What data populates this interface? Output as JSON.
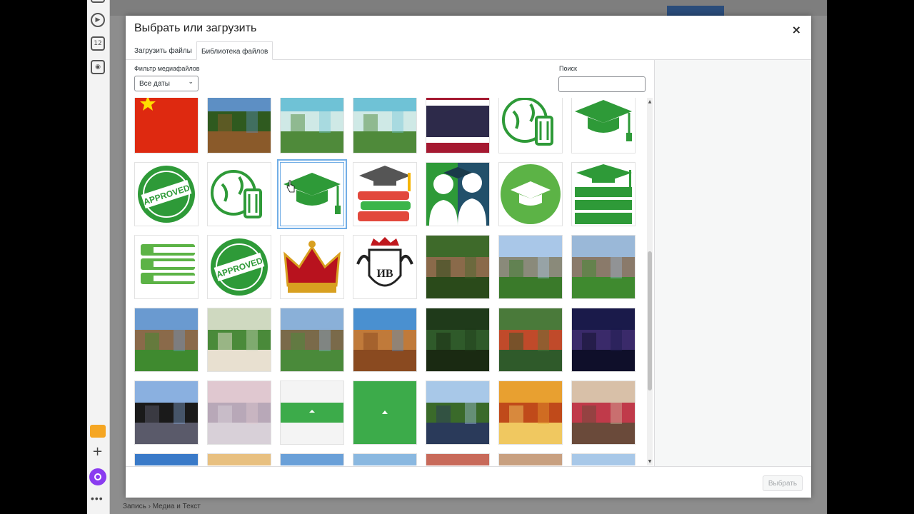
{
  "modal": {
    "title": "Выбрать или загрузить",
    "close_label": "×",
    "tabs": [
      {
        "label": "Загрузить файлы",
        "active": false
      },
      {
        "label": "Библиотека файлов",
        "active": true
      }
    ],
    "filter": {
      "label": "Фильтр медиафайлов",
      "selected": "Все даты"
    },
    "search": {
      "label": "Поиск",
      "placeholder": ""
    },
    "select_button": "Выбрать"
  },
  "browser": {
    "badge_count": "12"
  },
  "status_bar": {
    "breadcrumb": "Запись  ›  Медиа и Текст"
  },
  "media": [
    {
      "name": "china-flag",
      "kind": "flag-china"
    },
    {
      "name": "pagoda-lake",
      "kind": "photo",
      "colors": [
        "#5d8fc4",
        "#2f5a1f",
        "#8a5a2a"
      ]
    },
    {
      "name": "beach-boats",
      "kind": "photo",
      "colors": [
        "#6fc2d6",
        "#cfe9e6",
        "#4f8a3a"
      ]
    },
    {
      "name": "beach-boats-2",
      "kind": "photo",
      "colors": [
        "#6fc2d6",
        "#cfe9e6",
        "#4f8a3a"
      ]
    },
    {
      "name": "thai-flag",
      "kind": "flag-thai"
    },
    {
      "name": "globe-luggage-icon",
      "kind": "icon-globe"
    },
    {
      "name": "graduation-cap-icon",
      "kind": "icon-cap"
    },
    {
      "name": "approved-stamp",
      "kind": "icon-approved"
    },
    {
      "name": "globe-luggage-icon-2",
      "kind": "icon-globe"
    },
    {
      "name": "graduation-cap-icon-selected",
      "kind": "icon-cap",
      "selected": true
    },
    {
      "name": "books-cap-icon",
      "kind": "icon-books-color"
    },
    {
      "name": "students-icon",
      "kind": "icon-students"
    },
    {
      "name": "cap-circle-icon",
      "kind": "icon-cap-circle"
    },
    {
      "name": "books-cap-green-icon",
      "kind": "icon-books-green"
    },
    {
      "name": "books-green-icon",
      "kind": "icon-books-outline"
    },
    {
      "name": "approved-stamp-2",
      "kind": "icon-approved"
    },
    {
      "name": "crown-icon",
      "kind": "icon-crown"
    },
    {
      "name": "crest-icon",
      "kind": "icon-crest"
    },
    {
      "name": "castle-forest",
      "kind": "photo",
      "colors": [
        "#3e6a2a",
        "#8a6a4a",
        "#2a4a1a"
      ]
    },
    {
      "name": "palace-garden",
      "kind": "photo",
      "colors": [
        "#a9c7e8",
        "#8a8a7a",
        "#3a7a2a"
      ]
    },
    {
      "name": "college-lawn",
      "kind": "photo",
      "colors": [
        "#9ab8d8",
        "#8a7a6a",
        "#3f8a2f"
      ]
    },
    {
      "name": "students-lawn",
      "kind": "photo",
      "colors": [
        "#6a9ad0",
        "#8a6a4a",
        "#3f8a2f"
      ]
    },
    {
      "name": "students-sitting",
      "kind": "photo",
      "colors": [
        "#cfd9c0",
        "#4a8a3a",
        "#e8e0d0"
      ]
    },
    {
      "name": "mosque",
      "kind": "photo",
      "colors": [
        "#8ab0d8",
        "#7a6a4a",
        "#4a8a3a"
      ]
    },
    {
      "name": "desert-town",
      "kind": "photo",
      "colors": [
        "#4a90d0",
        "#c07a3a",
        "#8a4a20"
      ]
    },
    {
      "name": "jungle",
      "kind": "photo",
      "colors": [
        "#1f3a1a",
        "#2f5a2a",
        "#1a2a12"
      ]
    },
    {
      "name": "tea-woman",
      "kind": "photo",
      "colors": [
        "#4a7a3a",
        "#c04a2a",
        "#2f5a2a"
      ]
    },
    {
      "name": "night-palms",
      "kind": "photo",
      "colors": [
        "#1a1a4a",
        "#3a2a6a",
        "#0f0f2a"
      ]
    },
    {
      "name": "graduates-caps",
      "kind": "photo",
      "colors": [
        "#8ab0e0",
        "#1a1a1a",
        "#5a5a6a"
      ]
    },
    {
      "name": "passport-stamp",
      "kind": "photo",
      "colors": [
        "#e0c8d0",
        "#b8a8b8",
        "#d8d0d8"
      ]
    },
    {
      "name": "green-banner",
      "kind": "banner-green"
    },
    {
      "name": "green-square",
      "kind": "green-square"
    },
    {
      "name": "hiker-backpack",
      "kind": "photo",
      "colors": [
        "#a8c8e8",
        "#3a6a2a",
        "#2a3a5a"
      ]
    },
    {
      "name": "spices",
      "kind": "photo",
      "colors": [
        "#e8a030",
        "#c04a1a",
        "#f0c860"
      ]
    },
    {
      "name": "market-street",
      "kind": "photo",
      "colors": [
        "#d8c0a8",
        "#c03a4a",
        "#6a4a3a"
      ]
    },
    {
      "name": "canyon",
      "kind": "photo",
      "colors": [
        "#3a7ac8",
        "#c06a2a",
        "#8a4a1a"
      ]
    },
    {
      "name": "dunes",
      "kind": "photo",
      "colors": [
        "#e8c080",
        "#d09050",
        "#b07030"
      ]
    },
    {
      "name": "red-buildings",
      "kind": "photo",
      "colors": [
        "#6aa0d8",
        "#c05a3a",
        "#8a3a2a"
      ]
    },
    {
      "name": "old-city",
      "kind": "photo",
      "colors": [
        "#8ab8e0",
        "#d8c8a8",
        "#a08060"
      ]
    },
    {
      "name": "red-walls",
      "kind": "photo",
      "colors": [
        "#c86a5a",
        "#8a3a2a",
        "#e8a890"
      ]
    },
    {
      "name": "doorway-man",
      "kind": "photo",
      "colors": [
        "#c8a080",
        "#e8e0d8",
        "#8a5a3a"
      ]
    },
    {
      "name": "mountains-snow",
      "kind": "photo",
      "colors": [
        "#a8c8e8",
        "#ffffff",
        "#6a8aa8"
      ]
    }
  ]
}
